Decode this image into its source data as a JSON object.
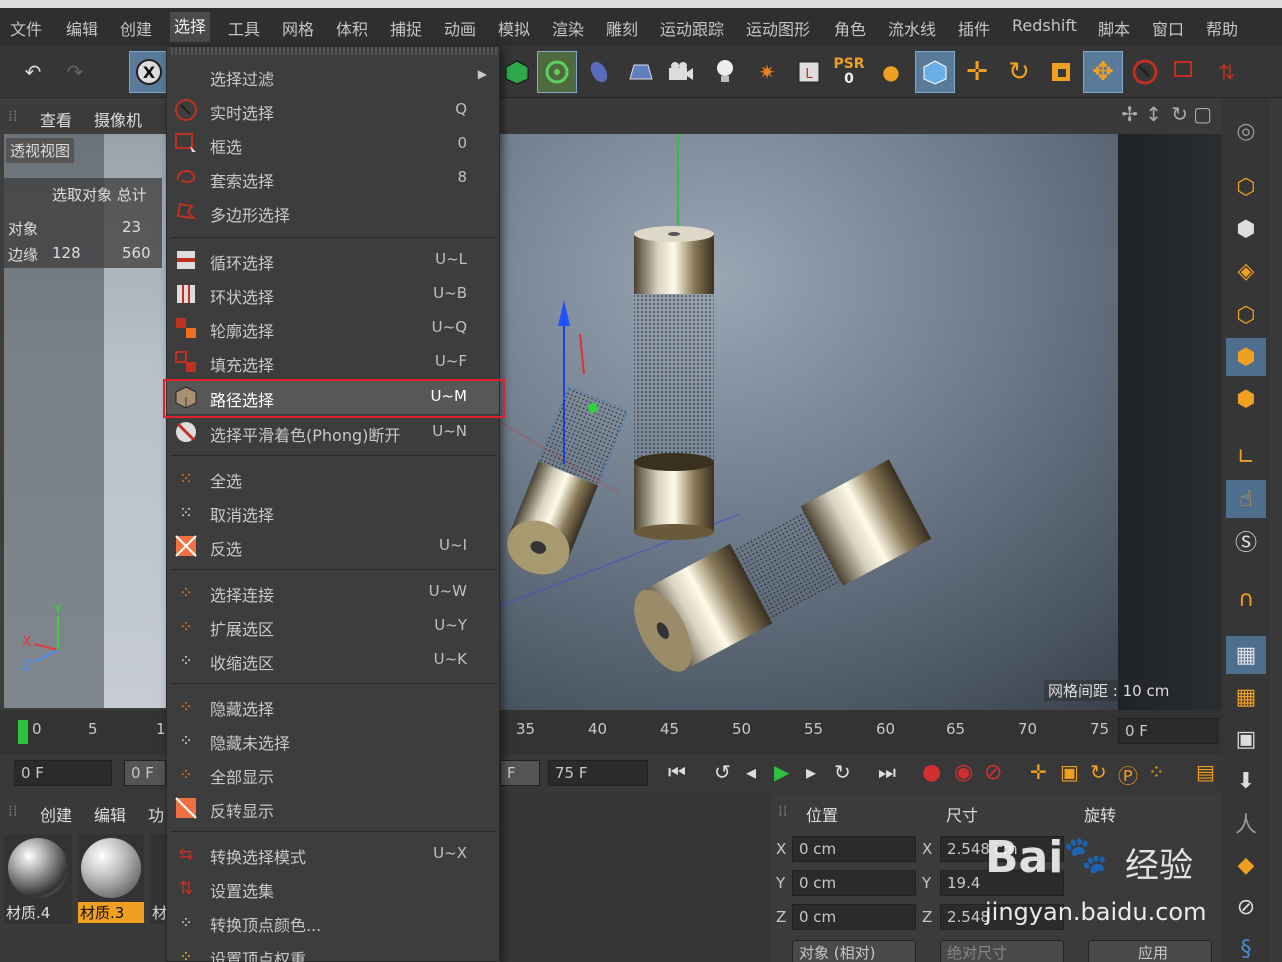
{
  "menubar": {
    "items": [
      "文件",
      "编辑",
      "创建",
      "选择",
      "工具",
      "网格",
      "体积",
      "捕捉",
      "动画",
      "模拟",
      "渲染",
      "雕刻",
      "运动跟踪",
      "运动图形",
      "角色",
      "流水线",
      "插件",
      "Redshift",
      "脚本",
      "窗口",
      "帮助"
    ],
    "active_index": 3
  },
  "toolbar": {
    "psr_label": "PSR",
    "psr_value": "0"
  },
  "viewport_menu": {
    "view": "查看",
    "camera": "摄像机"
  },
  "viewport": {
    "name": "透视视图",
    "stats_header": "选取对象 总计",
    "stats": [
      {
        "label": "对象",
        "selected": "",
        "total": "23"
      },
      {
        "label": "边缘",
        "selected": "128",
        "total": "560"
      }
    ],
    "grid_spacing": "网格间距 : 10 cm",
    "axes": {
      "x": "X",
      "y": "Y",
      "z": "Z"
    }
  },
  "select_menu": {
    "items": [
      {
        "label": "选择过滤",
        "shortcut": "",
        "submenu": true,
        "icon": "none"
      },
      {
        "label": "实时选择",
        "shortcut": "Q",
        "icon": "live-select-icon"
      },
      {
        "label": "框选",
        "shortcut": "0",
        "icon": "rect-select-icon"
      },
      {
        "label": "套索选择",
        "shortcut": "8",
        "icon": "lasso-select-icon"
      },
      {
        "label": "多边形选择",
        "shortcut": "",
        "icon": "polygon-select-icon"
      },
      {
        "label": "循环选择",
        "shortcut": "U~L",
        "icon": "loop-select-icon"
      },
      {
        "label": "环状选择",
        "shortcut": "U~B",
        "icon": "ring-select-icon"
      },
      {
        "label": "轮廓选择",
        "shortcut": "U~Q",
        "icon": "outline-select-icon"
      },
      {
        "label": "填充选择",
        "shortcut": "U~F",
        "icon": "fill-select-icon"
      },
      {
        "label": "路径选择",
        "shortcut": "U~M",
        "icon": "path-select-icon",
        "highlighted": true
      },
      {
        "label": "选择平滑着色(Phong)断开",
        "shortcut": "U~N",
        "icon": "phong-break-icon"
      },
      {
        "label": "全选",
        "shortcut": "",
        "icon": "select-all-icon"
      },
      {
        "label": "取消选择",
        "shortcut": "",
        "icon": "deselect-icon"
      },
      {
        "label": "反选",
        "shortcut": "U~I",
        "icon": "invert-select-icon"
      },
      {
        "label": "选择连接",
        "shortcut": "U~W",
        "icon": "select-connected-icon"
      },
      {
        "label": "扩展选区",
        "shortcut": "U~Y",
        "icon": "grow-selection-icon"
      },
      {
        "label": "收缩选区",
        "shortcut": "U~K",
        "icon": "shrink-selection-icon"
      },
      {
        "label": "隐藏选择",
        "shortcut": "",
        "icon": "hide-selected-icon"
      },
      {
        "label": "隐藏未选择",
        "shortcut": "",
        "icon": "hide-unselected-icon"
      },
      {
        "label": "全部显示",
        "shortcut": "",
        "icon": "unhide-all-icon"
      },
      {
        "label": "反转显示",
        "shortcut": "",
        "icon": "invert-visibility-icon"
      },
      {
        "label": "转换选择模式",
        "shortcut": "U~X",
        "icon": "convert-selection-icon"
      },
      {
        "label": "设置选集",
        "shortcut": "",
        "icon": "set-selection-icon"
      },
      {
        "label": "转换顶点颜色...",
        "shortcut": "",
        "icon": "vertex-color-icon"
      },
      {
        "label": "设置顶点权重...",
        "shortcut": "",
        "icon": "vertex-weight-icon"
      }
    ]
  },
  "timeline": {
    "ticks": [
      "0",
      "5",
      "1",
      "35",
      "40",
      "45",
      "50",
      "55",
      "60",
      "65",
      "70",
      "75"
    ],
    "end_field": "0 F",
    "start_field": "0 F",
    "current_field": "0 F",
    "mid_field": "F",
    "max_field": "75 F"
  },
  "materials": {
    "tabs": [
      "创建",
      "编辑",
      "功"
    ],
    "items": [
      {
        "name": "材质.4",
        "selected": false
      },
      {
        "name": "材质.3",
        "selected": true
      },
      {
        "name": "材",
        "selected": false
      }
    ]
  },
  "coordinates": {
    "headers": {
      "position": "位置",
      "size": "尺寸",
      "rotation": "旋转"
    },
    "rows": [
      {
        "axis": "X",
        "position": "0 cm",
        "size_axis": "X",
        "size": "2.548 cm"
      },
      {
        "axis": "Y",
        "position": "0 cm",
        "size_axis": "Y",
        "size": "19.4"
      },
      {
        "axis": "Z",
        "position": "0 cm",
        "size_axis": "Z",
        "size": "2.548"
      }
    ],
    "mode_dropdown": "对象 (相对)",
    "size_dropdown": "绝对尺寸",
    "apply_button": "应用"
  },
  "watermark": {
    "brand": "Bai",
    "brand2": "经验",
    "url": "jingyan.baidu.com"
  },
  "colors": {
    "accent_blue": "#5a7a9a",
    "highlight_box": "#e0202a",
    "material_selected": "#f0a020",
    "play_green": "#30c030"
  }
}
